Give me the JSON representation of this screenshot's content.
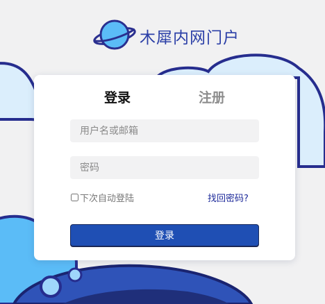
{
  "brand": {
    "title": "木犀内网门户",
    "logo_icon": "planet-icon"
  },
  "tabs": {
    "login_label": "登录",
    "register_label": "注册",
    "active": "login"
  },
  "form": {
    "username_placeholder": "用户名或邮箱",
    "password_placeholder": "密码",
    "remember_label": "下次自动登陆",
    "remember_checked": false,
    "forgot_label": "找回密码?",
    "submit_label": "登录"
  },
  "colors": {
    "accent": "#1f4fb4",
    "brand_text": "#2b3fa7",
    "link": "#1d2a9a",
    "background": "#f1f1f2"
  }
}
